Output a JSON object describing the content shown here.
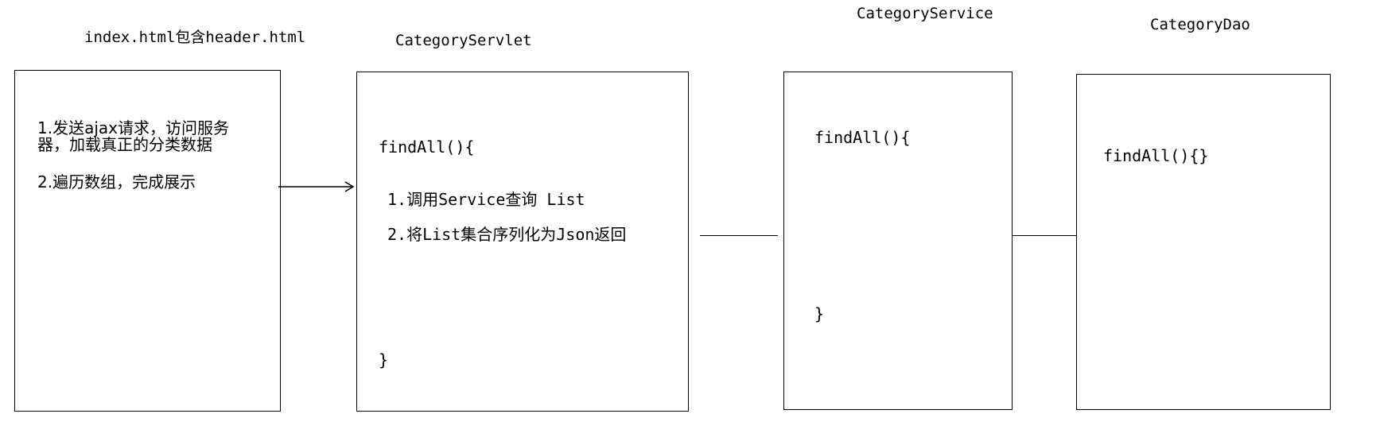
{
  "labels": {
    "index": "index.html包含header.html",
    "servlet": "CategoryServlet",
    "service": "CategoryService",
    "dao": "CategoryDao"
  },
  "index_box": {
    "step1_line1": "1.发送ajax请求，访问服务",
    "step1_line2": "器，加载真正的分类数据",
    "step2": "2.遍历数组，完成展示"
  },
  "servlet_box": {
    "method_open": "findAll(){",
    "step1": "1.调用Service查询  List",
    "step2": "2.将List集合序列化为Json返回",
    "method_close": "}"
  },
  "service_box": {
    "method_open": "findAll(){",
    "method_close": "}"
  },
  "dao_box": {
    "method": "findAll(){}"
  }
}
